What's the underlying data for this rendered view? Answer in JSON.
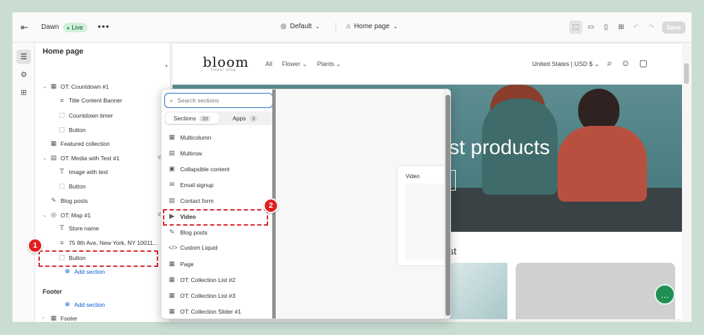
{
  "topbar": {
    "theme_name": "Dawn",
    "live_label": "Live",
    "more_label": "•••",
    "default_label": "Default",
    "page_select": "Home page",
    "save_label": "Save"
  },
  "sidebar": {
    "title": "Home page",
    "items": [
      {
        "label": "OT: Countdown #1"
      },
      {
        "label": "Title Content Banner"
      },
      {
        "label": "Countdown timer"
      },
      {
        "label": "Button"
      },
      {
        "label": "Featured collection"
      },
      {
        "label": "OT: Media with Text #1"
      },
      {
        "label": "Image with text"
      },
      {
        "label": "Button"
      },
      {
        "label": "Blog posts"
      },
      {
        "label": "OT: Map #1"
      },
      {
        "label": "Store name"
      },
      {
        "label": "75 9th Ave, New York, NY 10011..."
      },
      {
        "label": "Button"
      }
    ],
    "add_section": "Add section",
    "footer_title": "Footer",
    "footer_add_section": "Add section",
    "footer_item": "Footer"
  },
  "annotations": {
    "step1": "1",
    "step2": "2"
  },
  "store": {
    "logo": "bloom",
    "logo_sub": "flower shop",
    "nav": [
      "All",
      "Flower",
      "Plants"
    ],
    "currency": "United States | USD $",
    "hero_text": "st products",
    "section_title": "st"
  },
  "picker": {
    "search_placeholder": "Search sections",
    "tabs": [
      {
        "label": "Sections",
        "count": "20"
      },
      {
        "label": "Apps",
        "count": "3"
      }
    ],
    "items": [
      {
        "label": "Multicolumn",
        "icon": "grid-icon"
      },
      {
        "label": "Multirow",
        "icon": "rows-icon"
      },
      {
        "label": "Collapsible content",
        "icon": "collapsible-icon"
      },
      {
        "label": "Email signup",
        "icon": "email-icon"
      },
      {
        "label": "Contact form",
        "icon": "form-icon"
      },
      {
        "label": "Video",
        "icon": "play-icon"
      },
      {
        "label": "Blog posts",
        "icon": "blog-icon"
      },
      {
        "label": "Custom Liquid",
        "icon": "code-icon"
      },
      {
        "label": "Page",
        "icon": "page-icon"
      },
      {
        "label": "OT: Collection List #2",
        "icon": "grid-icon"
      },
      {
        "label": "OT: Collection List #3",
        "icon": "grid-icon"
      },
      {
        "label": "OT: Collection Slider #1",
        "icon": "grid-icon"
      }
    ],
    "preview_title": "Video"
  }
}
